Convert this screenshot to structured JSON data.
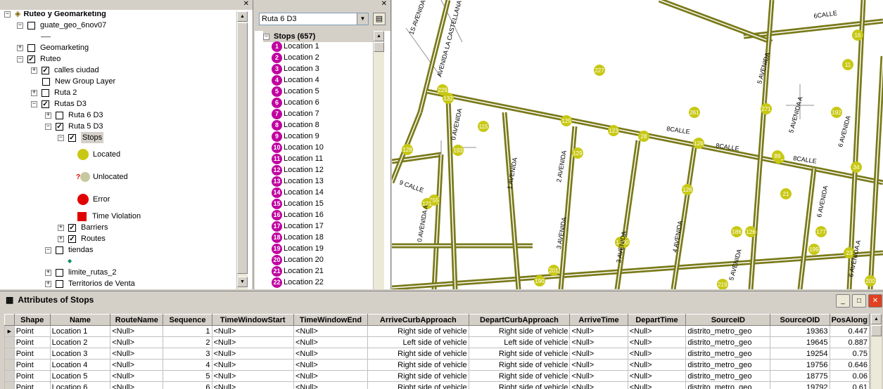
{
  "toc": {
    "close_glyph": "✕",
    "items": [
      {
        "label": "Ruteo y Geomarketing",
        "toggle": "−",
        "icon": "layers-icon",
        "bold": true
      },
      {
        "label": "guate_geo_6nov07",
        "toggle": "−",
        "checked": false
      },
      {
        "label": "—",
        "symbol": "line"
      },
      {
        "label": "Geomarketing",
        "toggle": "+",
        "checked": false
      },
      {
        "label": "Ruteo",
        "toggle": "−",
        "checked": true
      },
      {
        "label": "calles ciudad",
        "toggle": "+",
        "checked": true
      },
      {
        "label": "New Group Layer",
        "checked": false
      },
      {
        "label": "Ruta 2",
        "toggle": "+",
        "checked": false
      },
      {
        "label": "Rutas D3",
        "toggle": "−",
        "checked": true
      },
      {
        "label": "Ruta 6 D3",
        "toggle": "+",
        "checked": false
      },
      {
        "label": "Ruta 5 D3",
        "toggle": "−",
        "checked": true
      },
      {
        "label": "Stops",
        "toggle": "−",
        "checked": true,
        "selected": true
      },
      {
        "label": "Located",
        "symbol": "yellow-circle"
      },
      {
        "label": "Unlocated",
        "symbol": "question-circle"
      },
      {
        "label": "Error",
        "symbol": "red-circle"
      },
      {
        "label": "Time Violation",
        "symbol": "red-square"
      },
      {
        "label": "Barriers",
        "toggle": "+",
        "checked": true
      },
      {
        "label": "Routes",
        "toggle": "+",
        "checked": true
      },
      {
        "label": "tiendas",
        "toggle": "−",
        "checked": false
      },
      {
        "label": "◆",
        "symbol": "diamond"
      },
      {
        "label": "limite_rutas_2",
        "toggle": "+",
        "checked": false
      },
      {
        "label": "Territorios de Venta",
        "toggle": "+",
        "checked": false
      }
    ]
  },
  "network": {
    "close_glyph": "✕",
    "route_select": "Ruta 6 D3",
    "stops_header": "Stops (657)",
    "stops": [
      {
        "n": "1",
        "label": "Location 1"
      },
      {
        "n": "2",
        "label": "Location 2"
      },
      {
        "n": "3",
        "label": "Location 3"
      },
      {
        "n": "4",
        "label": "Location 4"
      },
      {
        "n": "5",
        "label": "Location 5"
      },
      {
        "n": "6",
        "label": "Location 6"
      },
      {
        "n": "7",
        "label": "Location 7"
      },
      {
        "n": "8",
        "label": "Location 8"
      },
      {
        "n": "9",
        "label": "Location 9"
      },
      {
        "n": "10",
        "label": "Location 10"
      },
      {
        "n": "11",
        "label": "Location 11"
      },
      {
        "n": "12",
        "label": "Location 12"
      },
      {
        "n": "13",
        "label": "Location 13"
      },
      {
        "n": "14",
        "label": "Location 14"
      },
      {
        "n": "15",
        "label": "Location 15"
      },
      {
        "n": "16",
        "label": "Location 16"
      },
      {
        "n": "17",
        "label": "Location 17"
      },
      {
        "n": "18",
        "label": "Location 18"
      },
      {
        "n": "19",
        "label": "Location 19"
      },
      {
        "n": "20",
        "label": "Location 20"
      },
      {
        "n": "21",
        "label": "Location 21"
      },
      {
        "n": "22",
        "label": "Location 22"
      }
    ]
  },
  "map": {
    "street_labels": [
      "6CALLE",
      "1S AVENIDA",
      "AVENIDA LA CASTELLANA",
      "5 AVENIDA",
      "5 AVENIDA A",
      "6 AVENIDA",
      "8CALLE",
      "8CALLE",
      "8CALLE",
      "0 AVENIDA",
      "1 AVENIDA",
      "2 AVENIDA",
      "9 CALLE",
      "0 AVENIDA A",
      "3 AVENIDA",
      "3 AVENIDA",
      "4 AVENIDA",
      "5 AVENIDA",
      "6 AVENIDA",
      "6 AVENIDA A"
    ],
    "stop_labels": [
      "227",
      "229",
      "11",
      "271",
      "192",
      "271",
      "16",
      "261",
      "132",
      "115",
      "125",
      "123",
      "28",
      "126",
      "89",
      "34",
      "193",
      "129",
      "128",
      "155",
      "121",
      "126",
      "21",
      "186",
      "177",
      "23",
      "180",
      "100",
      "201",
      "190",
      "199",
      "200",
      "219",
      "126"
    ],
    "road_color": "#7a7a1a",
    "road_fill": "#9a9a3a",
    "stop_color": "#c8c814"
  },
  "attributes": {
    "title": "Attributes of Stops",
    "min": "_",
    "max": "□",
    "close": "✕",
    "columns": [
      "Shape",
      "Name",
      "RouteName",
      "Sequence",
      "TimeWindowStart",
      "TimeWindowEnd",
      "ArriveCurbApproach",
      "DepartCurbApproach",
      "ArriveTime",
      "DepartTime",
      "SourceID",
      "SourceOID",
      "PosAlong"
    ],
    "rows": [
      [
        "Point",
        "Location 1",
        "<Null>",
        "1",
        "<Null>",
        "<Null>",
        "Right side of vehicle",
        "Right side of vehicle",
        "<Null>",
        "<Null>",
        "distrito_metro_geo",
        "19363",
        "0.447"
      ],
      [
        "Point",
        "Location 2",
        "<Null>",
        "2",
        "<Null>",
        "<Null>",
        "Left side of vehicle",
        "Left side of vehicle",
        "<Null>",
        "<Null>",
        "distrito_metro_geo",
        "19645",
        "0.887"
      ],
      [
        "Point",
        "Location 3",
        "<Null>",
        "3",
        "<Null>",
        "<Null>",
        "Right side of vehicle",
        "Right side of vehicle",
        "<Null>",
        "<Null>",
        "distrito_metro_geo",
        "19254",
        "0.75"
      ],
      [
        "Point",
        "Location 4",
        "<Null>",
        "4",
        "<Null>",
        "<Null>",
        "Right side of vehicle",
        "Right side of vehicle",
        "<Null>",
        "<Null>",
        "distrito_metro_geo",
        "19756",
        "0.646"
      ],
      [
        "Point",
        "Location 5",
        "<Null>",
        "5",
        "<Null>",
        "<Null>",
        "Right side of vehicle",
        "Right side of vehicle",
        "<Null>",
        "<Null>",
        "distrito_metro_geo",
        "18775",
        "0.06"
      ],
      [
        "Point",
        "Location 6",
        "<Null>",
        "6",
        "<Null>",
        "<Null>",
        "Right side of vehicle",
        "Right side of vehicle",
        "<Null>",
        "<Null>",
        "distrito_metro_geo",
        "19792",
        "0.61"
      ]
    ]
  }
}
